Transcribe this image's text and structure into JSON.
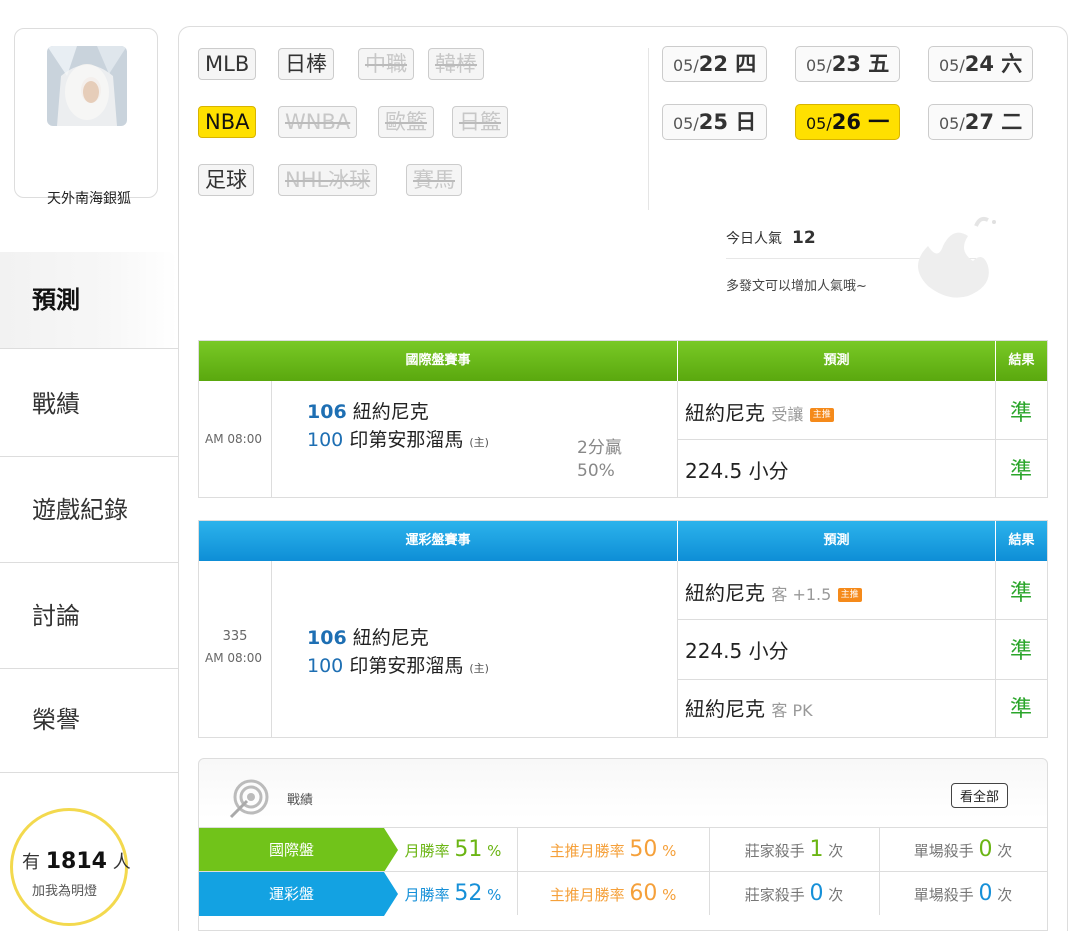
{
  "user": {
    "name": "天外南海銀狐"
  },
  "nav": [
    {
      "label": "預測"
    },
    {
      "label": "戰績"
    },
    {
      "label": "遊戲紀錄"
    },
    {
      "label": "討論"
    },
    {
      "label": "榮譽"
    }
  ],
  "fans": {
    "prefix": "有",
    "count": "1814",
    "suffix": "人",
    "caption": "加我為明燈"
  },
  "sports": {
    "row1": [
      "MLB",
      "日棒",
      "中職",
      "韓棒"
    ],
    "row2": [
      "NBA",
      "WNBA",
      "歐籃",
      "日籃"
    ],
    "row3": [
      "足球",
      "NHL冰球",
      "賽馬"
    ],
    "active": "NBA"
  },
  "dates": [
    {
      "md": "05/",
      "day": "22 四"
    },
    {
      "md": "05/",
      "day": "23 五"
    },
    {
      "md": "05/",
      "day": "24 六"
    },
    {
      "md": "05/",
      "day": "25 日"
    },
    {
      "md": "05/",
      "day": "26 一"
    },
    {
      "md": "05/",
      "day": "27 二"
    }
  ],
  "popularity": {
    "label": "今日人氣",
    "value": "12",
    "tip": "多發文可以增加人氣哦~"
  },
  "intl": {
    "headers": [
      "國際盤賽事",
      "預測",
      "結果"
    ],
    "time": "AM 08:00",
    "away_num": "106",
    "away_team": "紐約尼克",
    "home_num": "100",
    "home_team": "印第安那溜馬",
    "home_mark": "(主)",
    "spread": "2分贏",
    "pct": "50%",
    "preds": [
      {
        "team": "紐約尼克",
        "sub": "受讓",
        "tag": "主推",
        "result": "準"
      },
      {
        "team": "224.5 小分",
        "sub": "",
        "tag": "",
        "result": "準"
      }
    ]
  },
  "lottery": {
    "headers": [
      "運彩盤賽事",
      "預測",
      "結果"
    ],
    "game_no": "335",
    "time": "AM 08:00",
    "away_num": "106",
    "away_team": "紐約尼克",
    "home_num": "100",
    "home_team": "印第安那溜馬",
    "home_mark": "(主)",
    "preds": [
      {
        "team": "紐約尼克",
        "sub": "客 +1.5",
        "tag": "主推",
        "result": "準"
      },
      {
        "team": "224.5 小分",
        "sub": "",
        "tag": "",
        "result": "準"
      },
      {
        "team": "紐約尼克",
        "sub": "客 PK",
        "tag": "",
        "result": "準"
      }
    ]
  },
  "record": {
    "title": "戰績",
    "view_all": "看全部",
    "rows": [
      {
        "label": "國際盤",
        "win_label": "月勝率",
        "win": "51",
        "main_label": "主推月勝率",
        "main": "50",
        "pct": "%",
        "bank_label": "莊家殺手",
        "bank": "1",
        "single_label": "單場殺手",
        "single": "0",
        "times": "次"
      },
      {
        "label": "運彩盤",
        "win_label": "月勝率",
        "win": "52",
        "main_label": "主推月勝率",
        "main": "60",
        "pct": "%",
        "bank_label": "莊家殺手",
        "bank": "0",
        "single_label": "單場殺手",
        "single": "0",
        "times": "次"
      }
    ]
  },
  "colors": {
    "active": "#ffe000",
    "intl": "#6cbb1c",
    "lottery": "#1aa3e3",
    "hit": "#2aa52a"
  }
}
